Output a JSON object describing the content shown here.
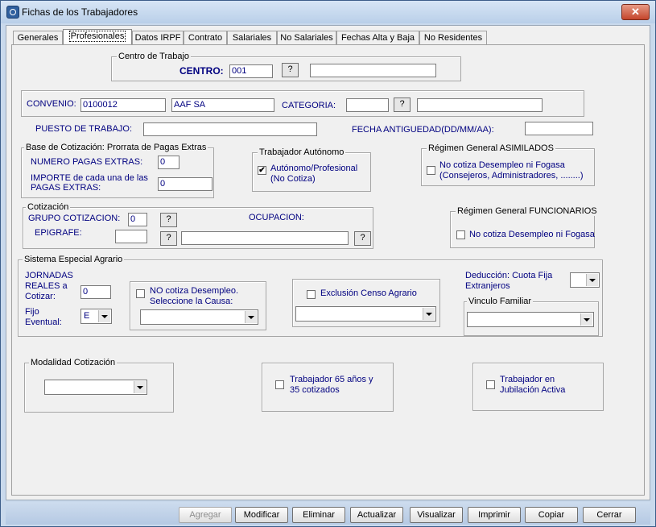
{
  "window": {
    "title": "Fichas de los Trabajadores",
    "close": "✕"
  },
  "tabs": [
    "Generales",
    "Profesionales",
    "Datos IRPF",
    "Contrato",
    "Salariales",
    "No Salariales",
    "Fechas Alta y Baja",
    "No Residentes"
  ],
  "centro": {
    "group_title": "Centro de Trabajo",
    "label": "CENTRO:",
    "code": "001",
    "lookup": "?",
    "name": ""
  },
  "convenio": {
    "label": "CONVENIO:",
    "code": "0100012",
    "name": "AAF SA",
    "categoria_label": "CATEGORIA:",
    "categoria_code": "",
    "lookup": "?",
    "categoria_name": ""
  },
  "puesto": {
    "label": "PUESTO DE TRABAJO:",
    "value": ""
  },
  "antiguedad": {
    "label": "FECHA ANTIGUEDAD(DD/MM/AA):",
    "value": ""
  },
  "pagas": {
    "group_title": "Base de Cotización: Prorrata de Pagas Extras",
    "numero_label": "NUMERO PAGAS EXTRAS:",
    "numero_value": "0",
    "importe_label_1": "IMPORTE de cada una de las",
    "importe_label_2": "PAGAS EXTRAS:",
    "importe_value": "0"
  },
  "autonomo": {
    "group_title": "Trabajador Autónomo",
    "check_label_1": "Autónomo/Profesional",
    "check_label_2": "(No Cotiza)",
    "checked_mark": "✔"
  },
  "asimilados": {
    "group_title": "Régimen General ASIMILADOS",
    "check_label_1": "No cotiza Desempleo ni Fogasa",
    "check_label_2": "(Consejeros, Administradores, ........)"
  },
  "cotizacion": {
    "group_title": "Cotización",
    "grupo_label": "GRUPO COTIZACION:",
    "grupo_value": "0",
    "epigrafe_label": "EPIGRAFE:",
    "epigrafe_value": "",
    "ocupacion_label": "OCUPACION:",
    "ocupacion_value": "",
    "lookup": "?"
  },
  "funcionarios": {
    "group_title": "Régimen General FUNCIONARIOS",
    "check_label": "No cotiza Desempleo ni Fogasa"
  },
  "agrario": {
    "group_title": "Sistema Especial Agrario",
    "jornadas_label_1": "JORNADAS",
    "jornadas_label_2": "REALES a",
    "jornadas_label_3": "Cotizar:",
    "jornadas_value": "0",
    "fijo_label_1": "Fijo",
    "fijo_label_2": "Eventual:",
    "fijo_value": "E",
    "nocotiza_label_1": "NO cotiza Desempleo.",
    "nocotiza_label_2": "Seleccione la Causa:",
    "causa_value": "",
    "exclusion_label": "Exclusión Censo Agrario",
    "exclusion_value": "",
    "deduccion_label_1": "Deducción: Cuota Fija",
    "deduccion_label_2": "Extranjeros",
    "deduccion_value": "",
    "vinculo_title": "Vinculo Familiar",
    "vinculo_value": ""
  },
  "modalidad": {
    "group_title": "Modalidad Cotización",
    "value": ""
  },
  "mayor65": {
    "label_1": "Trabajador 65 años y",
    "label_2": "35 cotizados"
  },
  "jubilacion": {
    "label_1": "Trabajador en",
    "label_2": "Jubilación Activa"
  },
  "footer": {
    "buttons": [
      "Agregar",
      "Modificar",
      "Eliminar",
      "Actualizar",
      "Visualizar",
      "Imprimir",
      "Copiar",
      "Cerrar"
    ]
  }
}
